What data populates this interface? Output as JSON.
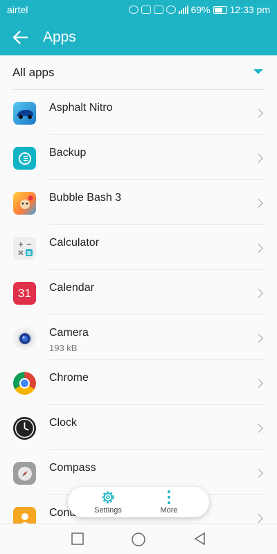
{
  "status_bar": {
    "carrier": "airtel",
    "battery": "69%",
    "time": "12:33 pm"
  },
  "app_bar": {
    "title": "Apps"
  },
  "filter": {
    "label": "All apps"
  },
  "apps": [
    {
      "name": "Asphalt Nitro",
      "size": "",
      "icon": "asphalt-nitro-icon"
    },
    {
      "name": "Backup",
      "size": "",
      "icon": "backup-icon"
    },
    {
      "name": "Bubble Bash 3",
      "size": "",
      "icon": "bubble-bash-icon"
    },
    {
      "name": "Calculator",
      "size": "",
      "icon": "calculator-icon"
    },
    {
      "name": "Calendar",
      "size": "",
      "icon": "calendar-icon",
      "icon_text": "31"
    },
    {
      "name": "Camera",
      "size": "193 kB",
      "icon": "camera-icon"
    },
    {
      "name": "Chrome",
      "size": "",
      "icon": "chrome-icon"
    },
    {
      "name": "Clock",
      "size": "",
      "icon": "clock-icon"
    },
    {
      "name": "Compass",
      "size": "",
      "icon": "compass-icon"
    },
    {
      "name": "Contacts",
      "size": "",
      "icon": "contacts-icon"
    }
  ],
  "actions": {
    "settings": "Settings",
    "more": "More"
  },
  "colors": {
    "accent": "#1fb3c6",
    "background": "#fafafa"
  }
}
